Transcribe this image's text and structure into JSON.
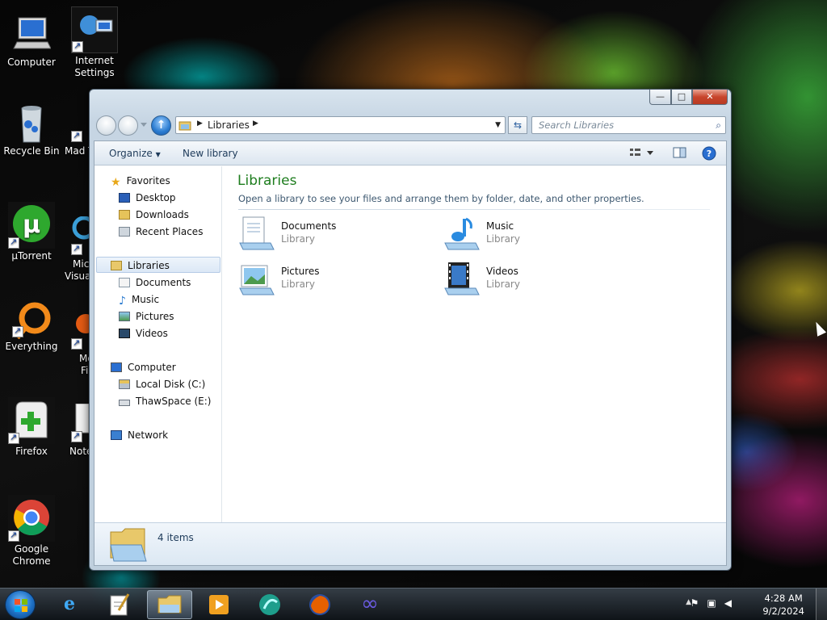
{
  "desktop": {
    "icons": [
      {
        "label": "Computer"
      },
      {
        "label_line1": "Internet",
        "label_line2": "Settings"
      },
      {
        "label": "Recycle Bin"
      },
      {
        "label": "Mad T"
      },
      {
        "label": "µTorrent"
      },
      {
        "label_line1": "Mic",
        "label_line2": "Visua"
      },
      {
        "label": "Everything"
      },
      {
        "label_line1": "Mo",
        "label_line2": "Fi"
      },
      {
        "label": "Firefox"
      },
      {
        "label": "Note"
      },
      {
        "label_line1": "Google",
        "label_line2": "Chrome"
      }
    ]
  },
  "window": {
    "controls": {
      "minimize": "—",
      "maximize": "□",
      "close": "✕"
    },
    "breadcrumb": "Libraries",
    "search_placeholder": "Search Libraries",
    "commands": {
      "organize": "Organize",
      "new_library": "New library"
    },
    "nav": {
      "favorites": "Favorites",
      "desktop": "Desktop",
      "downloads": "Downloads",
      "recent_places": "Recent Places",
      "libraries": "Libraries",
      "documents": "Documents",
      "music": "Music",
      "pictures": "Pictures",
      "videos": "Videos",
      "computer": "Computer",
      "local_disk": "Local Disk (C:)",
      "thawspace": "ThawSpace (E:)",
      "network": "Network"
    },
    "content": {
      "title": "Libraries",
      "subtitle": "Open a library to see your files and arrange them by folder, date, and other properties.",
      "items": [
        {
          "name": "Documents",
          "type": "Library"
        },
        {
          "name": "Music",
          "type": "Library"
        },
        {
          "name": "Pictures",
          "type": "Library"
        },
        {
          "name": "Videos",
          "type": "Library"
        }
      ]
    },
    "details": {
      "count": "4 items"
    }
  },
  "taskbar": {
    "clock_time": "4:28 AM",
    "clock_date": "9/2/2024"
  }
}
